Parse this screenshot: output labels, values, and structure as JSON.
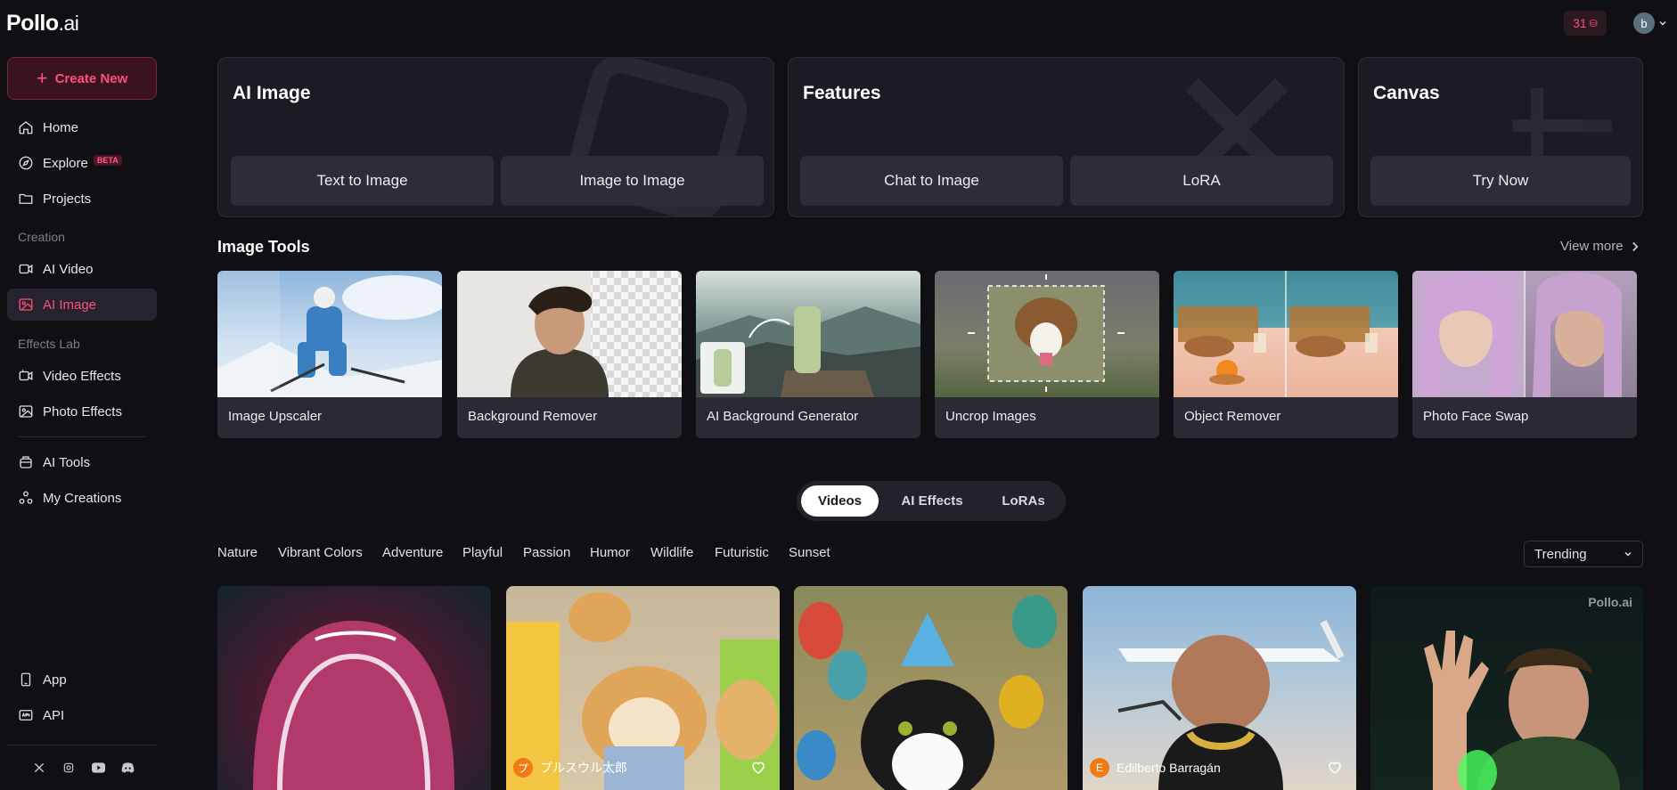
{
  "brand": {
    "logo_main": "Pollo",
    "logo_suffix": ".ai",
    "watermark": "Pollo.ai"
  },
  "header": {
    "credits": "31",
    "avatar_letter": "b"
  },
  "sidebar": {
    "create_label": "Create New",
    "items": [
      {
        "label": "Home",
        "icon": "home-icon"
      },
      {
        "label": "Explore",
        "badge": "BETA",
        "icon": "compass-icon"
      },
      {
        "label": "Projects",
        "icon": "folder-icon"
      }
    ],
    "creation_label": "Creation",
    "creation_items": [
      {
        "label": "AI Video",
        "icon": "video-icon"
      },
      {
        "label": "AI Image",
        "icon": "image-icon",
        "active": true
      }
    ],
    "effects_label": "Effects Lab",
    "effects_items": [
      {
        "label": "Video Effects",
        "icon": "video-effects-icon"
      },
      {
        "label": "Photo Effects",
        "icon": "photo-effects-icon"
      }
    ],
    "other_items": [
      {
        "label": "AI Tools",
        "icon": "tools-icon"
      },
      {
        "label": "My Creations",
        "icon": "creations-icon"
      }
    ],
    "bottom_items": [
      {
        "label": "App",
        "icon": "phone-icon"
      },
      {
        "label": "API",
        "icon": "api-icon"
      }
    ],
    "socials": [
      "x-icon",
      "instagram-icon",
      "youtube-icon",
      "discord-icon"
    ]
  },
  "cards": {
    "ai_image": {
      "title": "AI Image",
      "buttons": [
        "Text to Image",
        "Image to Image"
      ]
    },
    "features": {
      "title": "Features",
      "buttons": [
        "Chat to Image",
        "LoRA"
      ]
    },
    "canvas": {
      "title": "Canvas",
      "buttons": [
        "Try Now"
      ]
    }
  },
  "image_tools": {
    "title": "Image Tools",
    "view_more": "View more",
    "tools": [
      "Image Upscaler",
      "Background Remover",
      "AI Background Generator",
      "Uncrop Images",
      "Object Remover",
      "Photo Face Swap"
    ]
  },
  "tabs": [
    "Videos",
    "AI Effects",
    "LoRAs"
  ],
  "active_tab": "Videos",
  "filters": [
    "Nature",
    "Vibrant Colors",
    "Adventure",
    "Playful",
    "Passion",
    "Humor",
    "Wildlife",
    "Futuristic",
    "Sunset"
  ],
  "sort": {
    "value": "Trending"
  },
  "videos": [
    {
      "author": ""
    },
    {
      "author": "プルスウル太郎",
      "avatar": "プ"
    },
    {
      "author": ""
    },
    {
      "author": "Edilberto Barragán",
      "avatar": "E"
    },
    {
      "author": ""
    }
  ],
  "colors": {
    "accent": "#ff4f7b",
    "background": "#0f0f14",
    "card": "#1c1b24"
  }
}
